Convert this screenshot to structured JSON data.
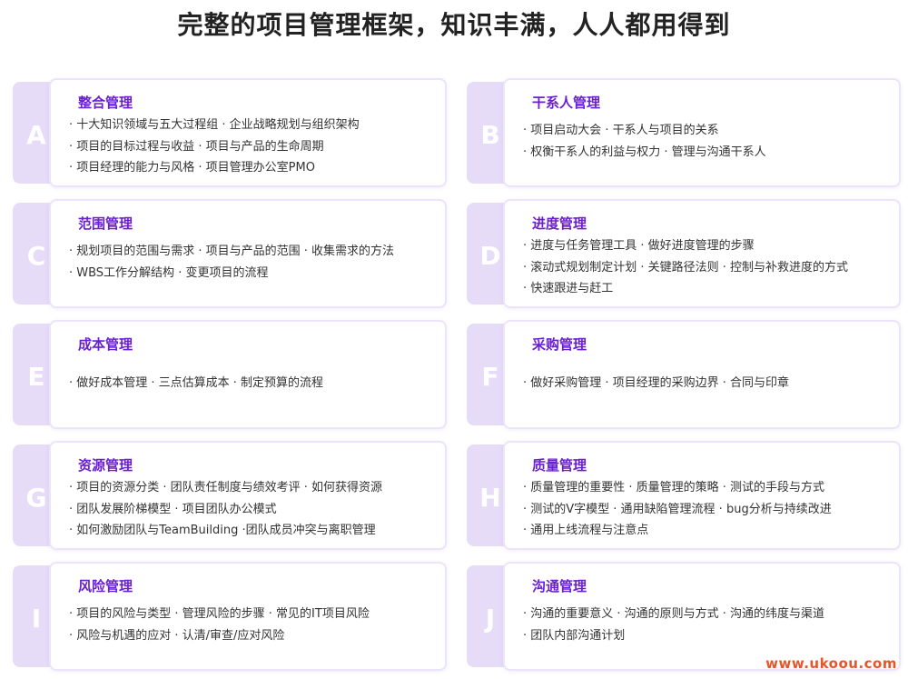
{
  "headline": "完整的项目管理框架，知识丰满，人人都用得到",
  "cards": [
    {
      "letter": "A",
      "title": "整合管理",
      "lines": [
        "· 十大知识领域与五大过程组  · 企业战略规划与组织架构",
        "· 项目的目标过程与收益        · 项目与产品的生命周期",
        "· 项目经理的能力与风格        · 项目管理办公室PMO"
      ]
    },
    {
      "letter": "B",
      "title": "干系人管理",
      "lines": [
        "· 项目启动大会                          · 干系人与项目的关系",
        "· 权衡干系人的利益与权力          · 管理与沟通干系人"
      ]
    },
    {
      "letter": "C",
      "title": "范围管理",
      "lines": [
        "· 规划项目的范围与需求 · 项目与产品的范围 · 收集需求的方法",
        "· WBS工作分解结构        · 变更项目的流程"
      ]
    },
    {
      "letter": "D",
      "title": "进度管理",
      "lines": [
        "· 进度与任务管理工具 · 做好进度管理的步骤",
        "· 滚动式规划制定计划 · 关键路径法则 · 控制与补救进度的方式",
        "· 快速跟进与赶工"
      ]
    },
    {
      "letter": "E",
      "title": "成本管理",
      "lines": [
        "· 做好成本管理 · 三点估算成本 · 制定预算的流程"
      ]
    },
    {
      "letter": "F",
      "title": "采购管理",
      "lines": [
        "· 做好采购管理 · 项目经理的采购边界 · 合同与印章"
      ]
    },
    {
      "letter": "G",
      "title": "资源管理",
      "lines": [
        "· 项目的资源分类        · 团队责任制度与绩效考评 · 如何获得资源",
        "· 团队发展阶梯模型    · 项目团队办公模式",
        "· 如何激励团队与TeamBuilding  ·团队成员冲突与离职管理"
      ]
    },
    {
      "letter": "H",
      "title": "质量管理",
      "lines": [
        "· 质量管理的重要性 · 质量管理的策略    · 测试的手段与方式",
        "· 测试的V字模型      · 通用缺陷管理流程 · bug分析与持续改进",
        "· 通用上线流程与注意点"
      ]
    },
    {
      "letter": "I",
      "title": "风险管理",
      "lines": [
        "· 项目的风险与类型 · 管理风险的步骤 · 常见的IT项目风险",
        "· 风险与机遇的应对 · 认清/审查/应对风险"
      ]
    },
    {
      "letter": "J",
      "title": "沟通管理",
      "lines": [
        "· 沟通的重要意义 · 沟通的原则与方式 · 沟通的纬度与渠道",
        "· 团队内部沟通计划"
      ]
    }
  ],
  "watermark": "www.ukoou.com"
}
